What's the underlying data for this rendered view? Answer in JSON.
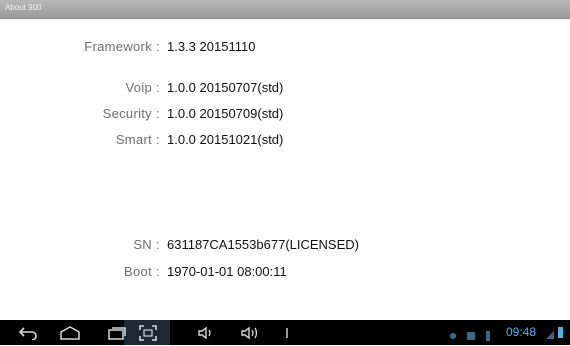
{
  "window": {
    "title": "About 900"
  },
  "info": {
    "framework": {
      "label": "Framework",
      "value": "1.3.3 20151110"
    },
    "voip": {
      "label": "Voip",
      "value": "1.0.0 20150707(std)"
    },
    "security": {
      "label": "Security",
      "value": "1.0.0 20150709(std)"
    },
    "smart": {
      "label": "Smart",
      "value": "1.0.0 20151021(std)"
    },
    "sn": {
      "label": "SN",
      "value": "631187CA1553b677(LICENSED)"
    },
    "boot": {
      "label": "Boot",
      "value": "1970-01-01 08:00:11"
    },
    "separator": ":"
  },
  "navbar": {
    "icons": [
      "back-icon",
      "home-icon",
      "recent-apps-icon",
      "screenshot-icon",
      "volume-down-icon",
      "volume-up-icon",
      "menu-icon"
    ],
    "status_icons": [
      "notification-icon",
      "sd-card-icon",
      "usb-icon",
      "wifi-icon",
      "battery-icon"
    ],
    "clock": "09:48",
    "accent_color": "#4fb3e8"
  }
}
